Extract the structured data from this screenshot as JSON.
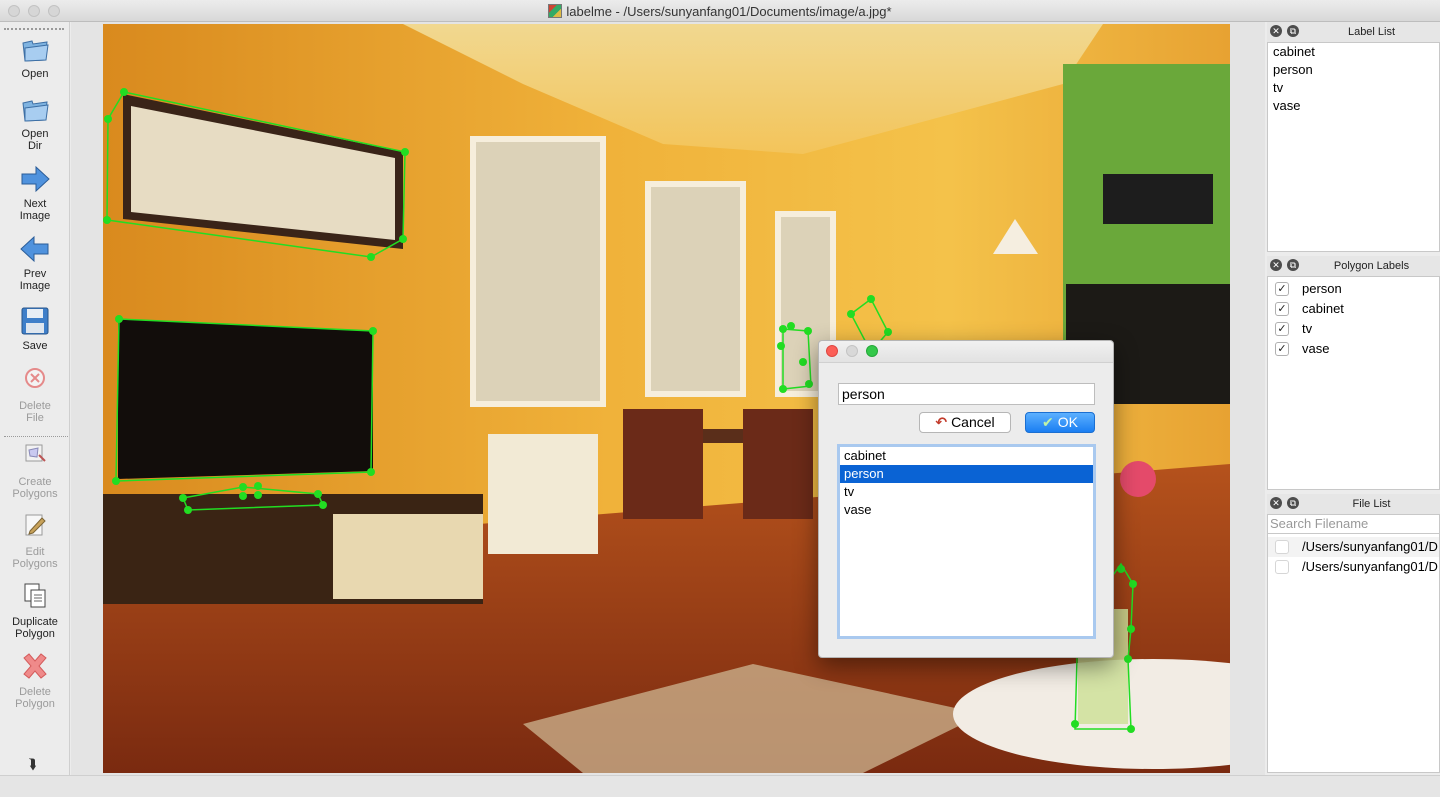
{
  "window": {
    "title": "labelme - /Users/sunyanfang01/Documents/image/a.jpg*"
  },
  "toolbar": {
    "open": "Open",
    "open_dir": "Open\nDir",
    "next_image": "Next\nImage",
    "prev_image": "Prev\nImage",
    "save": "Save",
    "delete_file": "Delete\nFile",
    "create_polygons": "Create\nPolygons",
    "edit_polygons": "Edit\nPolygons",
    "duplicate_polygon": "Duplicate\nPolygon",
    "delete_polygon": "Delete\nPolygon"
  },
  "label_list": {
    "title": "Label List",
    "items": [
      "cabinet",
      "person",
      "tv",
      "vase"
    ]
  },
  "polygon_labels": {
    "title": "Polygon Labels",
    "items": [
      {
        "label": "person",
        "checked": true
      },
      {
        "label": "cabinet",
        "checked": true
      },
      {
        "label": "tv",
        "checked": true
      },
      {
        "label": "vase",
        "checked": true
      }
    ]
  },
  "file_list": {
    "title": "File List",
    "search_placeholder": "Search Filename",
    "items": [
      "/Users/sunyanfang01/D",
      "/Users/sunyanfang01/D"
    ]
  },
  "dialog": {
    "input_value": "person",
    "cancel_label": "Cancel",
    "ok_label": "OK",
    "items": [
      "cabinet",
      "person",
      "tv",
      "vase"
    ],
    "selected": "person"
  },
  "colors": {
    "accent": "#0a63d4",
    "polygon": "#22dd22"
  }
}
